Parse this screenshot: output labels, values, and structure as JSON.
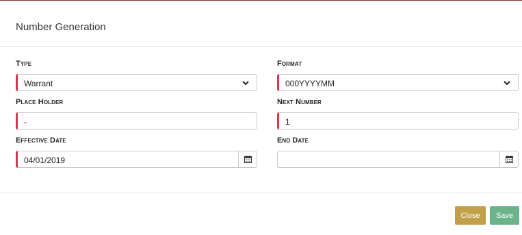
{
  "dialog": {
    "title": "Number Generation"
  },
  "fields": {
    "type": {
      "label": "Type",
      "value": "Warrant"
    },
    "format": {
      "label": "Format",
      "value": "000YYYYMM"
    },
    "place_holder": {
      "label": "Place Holder",
      "value": "-"
    },
    "next_number": {
      "label": "Next Number",
      "value": "1"
    },
    "effective_date": {
      "label": "Effective Date",
      "value": "04/01/2019"
    },
    "end_date": {
      "label": "End Date",
      "value": ""
    }
  },
  "buttons": {
    "close_label": "Close",
    "save_label": "Save"
  },
  "icons": {
    "dropdown": "chevron-down-icon",
    "calendar": "calendar-icon"
  },
  "colors": {
    "required_marker": "#d9364f",
    "close_button": "#c0a04a",
    "save_button": "#6cb38c"
  }
}
